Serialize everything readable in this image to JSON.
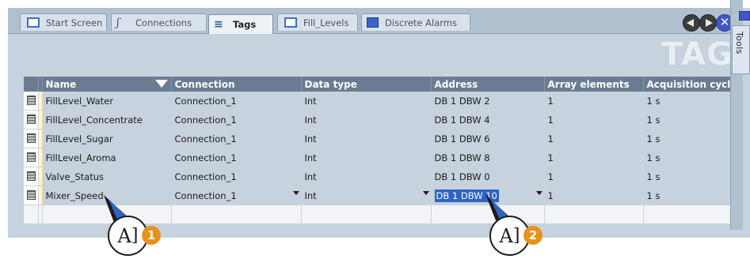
{
  "tabs": [
    {
      "label": "Start Screen",
      "icon": "screen-icon",
      "active": false
    },
    {
      "label": "Connections",
      "icon": "connections-icon",
      "active": false
    },
    {
      "label": "Tags",
      "icon": "tags-icon",
      "active": true
    },
    {
      "label": "Fill_Levels",
      "icon": "screen-icon",
      "active": false
    },
    {
      "label": "Discrete Alarms",
      "icon": "alarm-icon",
      "active": false
    }
  ],
  "nav": {
    "prev_icon": "arrow-left-icon",
    "next_icon": "arrow-right-icon",
    "close_icon": "close-icon",
    "close_glyph": "✕"
  },
  "tools_label": "Tools",
  "editor_title": "TAGS",
  "table": {
    "columns": [
      "Name",
      "Connection",
      "Data type",
      "Address",
      "Array elements",
      "Acquisition cycle"
    ],
    "rows": [
      [
        "FillLevel_Water",
        "Connection_1",
        "Int",
        "DB 1 DBW 2",
        "1",
        "1 s"
      ],
      [
        "FillLevel_Concentrate",
        "Connection_1",
        "Int",
        "DB 1 DBW 4",
        "1",
        "1 s"
      ],
      [
        "FillLevel_Sugar",
        "Connection_1",
        "Int",
        "DB 1 DBW 6",
        "1",
        "1 s"
      ],
      [
        "FillLevel_Aroma",
        "Connection_1",
        "Int",
        "DB 1 DBW 8",
        "1",
        "1 s"
      ],
      [
        "Valve_Status",
        "Connection_1",
        "Int",
        "DB 1 DBW 0",
        "1",
        "1 s"
      ],
      [
        "Mixer_Speed",
        "Connection_1",
        "Int",
        "DB 1 DBW 10",
        "1",
        "1 s"
      ]
    ]
  },
  "callouts": [
    {
      "glyph": "A",
      "number": "1"
    },
    {
      "glyph": "A",
      "number": "2"
    }
  ],
  "colors": {
    "header": "#6b7c92",
    "selection": "#2f63c5",
    "callout_badge": "#e8911c",
    "tab_bar": "#b1c0cf"
  }
}
